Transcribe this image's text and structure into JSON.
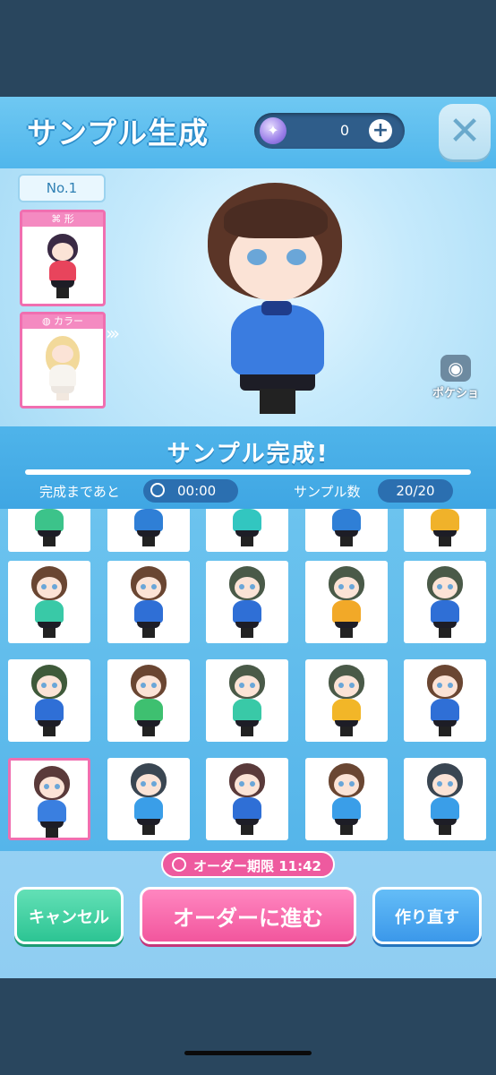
{
  "header": {
    "title": "サンプル生成",
    "currency_value": "0",
    "currency_icon": "star-gem-icon",
    "close_icon": "close-x-icon"
  },
  "left_panel": {
    "number_label": "No.1",
    "shape_label": "形",
    "color_label": "カラー"
  },
  "pokesho": {
    "label": "ポケショ",
    "icon": "camera-icon"
  },
  "status": {
    "title": "サンプル完成!",
    "timer_label": "完成まであと",
    "timer_value": "00:00",
    "count_label": "サンプル数",
    "count_value": "20/20"
  },
  "samples": [
    {
      "hair": "#3a5a3a",
      "body": "#3cc38a"
    },
    {
      "hair": "#3a4a6a",
      "body": "#2f7fd6"
    },
    {
      "hair": "#3a5a5a",
      "body": "#32c6c0"
    },
    {
      "hair": "#3a4a6a",
      "body": "#2f7fd6"
    },
    {
      "hair": "#5a4a2a",
      "body": "#f0b22a"
    },
    {
      "hair": "#6a4632",
      "body": "#39c9a7"
    },
    {
      "hair": "#6a4632",
      "body": "#2f6fd6"
    },
    {
      "hair": "#4a5a48",
      "body": "#2f6fd6"
    },
    {
      "hair": "#4a5a48",
      "body": "#f2a928"
    },
    {
      "hair": "#4a5a48",
      "body": "#2f6fd6"
    },
    {
      "hair": "#3f5a3a",
      "body": "#2f6fd6"
    },
    {
      "hair": "#6a4632",
      "body": "#3ec070"
    },
    {
      "hair": "#4a5a48",
      "body": "#39c9a7"
    },
    {
      "hair": "#4a5a48",
      "body": "#f2b628"
    },
    {
      "hair": "#6a4632",
      "body": "#2f6fd6"
    },
    {
      "hair": "#5a3a3a",
      "body": "#3a7fe0"
    },
    {
      "hair": "#3a4652",
      "body": "#3a9ee8"
    },
    {
      "hair": "#5a3a3a",
      "body": "#2f6fd6"
    },
    {
      "hair": "#6a4632",
      "body": "#3a9ee8"
    },
    {
      "hair": "#3a4652",
      "body": "#3a9ee8"
    }
  ],
  "selected_index": 15,
  "footer": {
    "deadline_label": "オーダー期限 11:42",
    "cancel_label": "キャンセル",
    "order_label": "オーダーに進む",
    "redo_label": "作り直す"
  }
}
